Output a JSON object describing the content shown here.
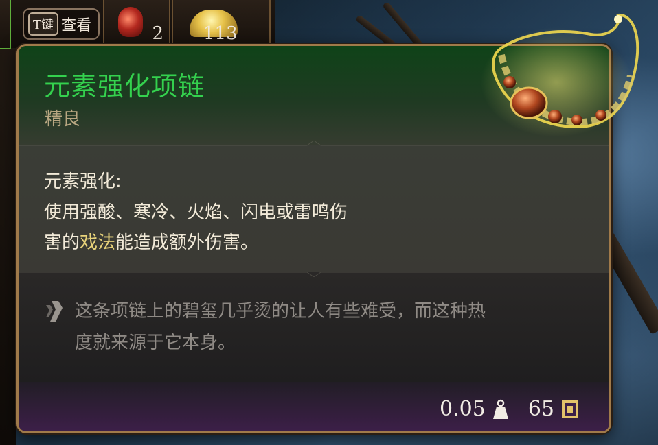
{
  "background": {
    "keyhint": {
      "key": "T键",
      "label": "查看"
    },
    "slots": [
      {
        "icon": "red-potion-icon",
        "count": "2"
      },
      {
        "icon": "gold-pile-icon",
        "count": "113"
      }
    ]
  },
  "tooltip": {
    "item_name": "元素强化项链",
    "rarity": "精良",
    "ability": {
      "name": "元素强化:",
      "desc_line1": "使用强酸、寒冷、火焰、闪电或雷鸣伤",
      "desc_line2_prefix": "害的",
      "desc_line2_highlight": "戏法",
      "desc_line2_suffix": "能造成额外伤害。"
    },
    "flavor_text_line1": "这条项链上的碧玺几乎烫的让人有些难受，而这种热",
    "flavor_text_line2": "度就来源于它本身。",
    "weight": "0.05",
    "value": "65",
    "icons": {
      "weight": "weight-icon",
      "value": "gold-coin-icon",
      "flavor": "quote-mark-icon"
    }
  },
  "colors": {
    "item_name": "#34d14e",
    "rarity": "#b9a782",
    "highlight": "#e7d27a",
    "flavor": "#8f8a85",
    "border": "#a07a4a"
  }
}
